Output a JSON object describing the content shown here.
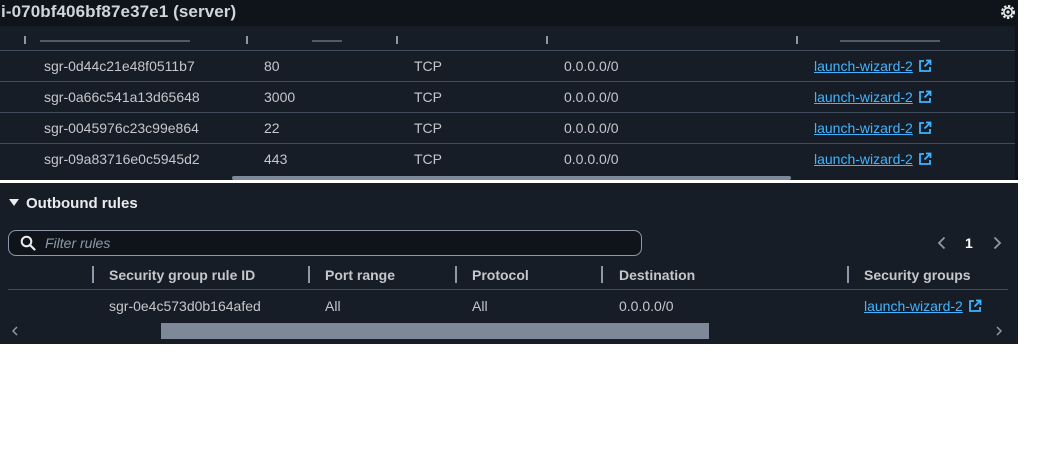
{
  "header": {
    "instance_title": "i-070bf406bf87e37e1 (server)"
  },
  "inbound": {
    "rows": [
      {
        "rule_id": "sgr-0d44c21e48f0511b7",
        "port_range": "80",
        "protocol": "TCP",
        "source": "0.0.0.0/0",
        "security_group": "launch-wizard-2"
      },
      {
        "rule_id": "sgr-0a66c541a13d65648",
        "port_range": "3000",
        "protocol": "TCP",
        "source": "0.0.0.0/0",
        "security_group": "launch-wizard-2"
      },
      {
        "rule_id": "sgr-0045976c23c99e864",
        "port_range": "22",
        "protocol": "TCP",
        "source": "0.0.0.0/0",
        "security_group": "launch-wizard-2"
      },
      {
        "rule_id": "sgr-09a83716e0c5945d2",
        "port_range": "443",
        "protocol": "TCP",
        "source": "0.0.0.0/0",
        "security_group": "launch-wizard-2"
      }
    ]
  },
  "outbound": {
    "title": "Outbound rules",
    "filter_placeholder": "Filter rules",
    "current_page": "1",
    "columns": {
      "rule_id": "Security group rule ID",
      "port_range": "Port range",
      "protocol": "Protocol",
      "destination": "Destination",
      "security_groups": "Security groups"
    },
    "rows": [
      {
        "rule_id": "sgr-0e4c573d0b164afed",
        "port_range": "All",
        "protocol": "All",
        "destination": "0.0.0.0/0",
        "security_group": "launch-wizard-2"
      }
    ]
  },
  "icons": {
    "settings": "gear-icon",
    "external_link": "external-link-icon",
    "search": "search-icon",
    "collapse": "caret-down-icon",
    "prev": "chevron-left-icon",
    "next": "chevron-right-icon"
  },
  "colors": {
    "background": "#0f141a",
    "panel": "#161d26",
    "link": "#42b4ff",
    "text": "#c6c6cd",
    "divider": "#414d5c"
  }
}
